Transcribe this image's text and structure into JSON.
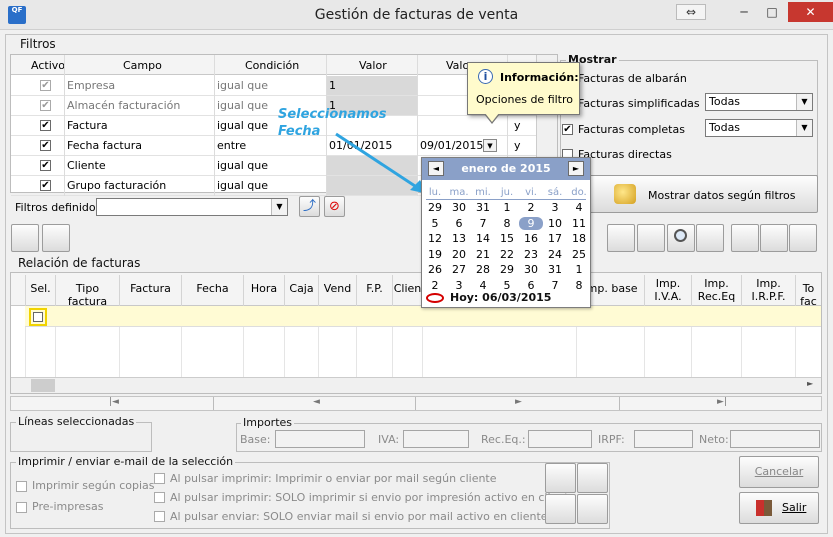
{
  "window": {
    "title": "Gestión de facturas de venta",
    "logo_text": "QF",
    "restore_icon": "⇔",
    "minimize_icon": "─",
    "maximize_icon": "□",
    "close_icon": "✕"
  },
  "filtros": {
    "label": "Filtros",
    "headers": [
      "Activo",
      "Campo",
      "Condición",
      "Valor",
      "Valor"
    ],
    "rows": [
      {
        "checked": true,
        "dim": true,
        "campo": "Empresa",
        "condicion": "igual que",
        "valor": "1",
        "valor2": "",
        "extra": ""
      },
      {
        "checked": true,
        "dim": true,
        "campo": "Almacén facturación",
        "condicion": "igual que",
        "valor": "1",
        "valor2": "",
        "extra": ""
      },
      {
        "checked": true,
        "dim": false,
        "campo": "Factura",
        "condicion": "igual que",
        "valor": "",
        "valor2": "",
        "extra": "y"
      },
      {
        "checked": true,
        "dim": false,
        "campo": "Fecha factura",
        "condicion": "entre",
        "valor": "01/01/2015",
        "valor2": "09/01/2015",
        "extra": "y"
      },
      {
        "checked": true,
        "dim": false,
        "campo": "Cliente",
        "condicion": "igual que",
        "valor": "",
        "valor2": "",
        "extra": ""
      },
      {
        "checked": true,
        "dim": false,
        "campo": "Grupo facturación",
        "condicion": "igual que",
        "valor": "",
        "valor2": "",
        "extra": ""
      }
    ],
    "definidos_label": "Filtros definidos:",
    "definidos_value": ""
  },
  "tooltip": {
    "title": "Información:",
    "body": "Opciones de filtro"
  },
  "annotation": {
    "line1": "Seleccionamos",
    "line2": "Fecha"
  },
  "mostrar": {
    "label": "Mostrar",
    "options": [
      {
        "label": "Facturas de albarán",
        "checked": false,
        "select": null
      },
      {
        "label": "Facturas simplificadas",
        "checked": false,
        "select": "Todas"
      },
      {
        "label": "Facturas completas",
        "checked": true,
        "select": "Todas"
      },
      {
        "label": "Facturas directas",
        "checked": false,
        "select": null
      }
    ],
    "button_label": "Mostrar datos según filtros"
  },
  "calendar": {
    "month": "enero de 2015",
    "prev_icon": "◄",
    "next_icon": "►",
    "dow": [
      "lu.",
      "ma.",
      "mi.",
      "ju.",
      "vi.",
      "sá.",
      "do."
    ],
    "weeks": [
      [
        "29",
        "30",
        "31",
        "1",
        "2",
        "3",
        "4"
      ],
      [
        "5",
        "6",
        "7",
        "8",
        "9",
        "10",
        "11"
      ],
      [
        "12",
        "13",
        "14",
        "15",
        "16",
        "17",
        "18"
      ],
      [
        "19",
        "20",
        "21",
        "22",
        "23",
        "24",
        "25"
      ],
      [
        "26",
        "27",
        "28",
        "29",
        "30",
        "31",
        "1"
      ],
      [
        "2",
        "3",
        "4",
        "5",
        "6",
        "7",
        "8"
      ]
    ],
    "selected": "9",
    "today_text": "Hoy: 06/03/2015"
  },
  "relacion": {
    "label": "Relación de facturas",
    "headers": [
      "Sel.",
      "Tipo factura",
      "Factura",
      "Fecha",
      "Hora",
      "Caja",
      "Vend",
      "F.P.",
      "Clien",
      "",
      "Imp. base",
      "Imp. I.V.A.",
      "Imp. Rec.Eq",
      "Imp. I.R.P.F.",
      "To fac"
    ],
    "nav": [
      "|◄",
      "◄",
      "►",
      "►|"
    ]
  },
  "lineas": {
    "label": "Líneas seleccionadas"
  },
  "importes": {
    "label": "Importes",
    "base": "Base:",
    "iva": "IVA:",
    "receq": "Rec.Eq.:",
    "irpf": "IRPF:",
    "neto": "Neto:"
  },
  "imprimir": {
    "label": "Imprimir / enviar e-mail de la selección",
    "copias": "Imprimir según copias",
    "preimpresas": "Pre-impresas",
    "opt1": "Al pulsar imprimir: Imprimir o enviar por mail según cliente",
    "opt2": "Al pulsar imprimir: SOLO imprimir si envio por impresión activo en cliente",
    "opt3": "Al pulsar enviar: SOLO enviar mail si envio por mail activo en cliente"
  },
  "actions": {
    "cancelar": "Cancelar",
    "salir": "Salir"
  }
}
